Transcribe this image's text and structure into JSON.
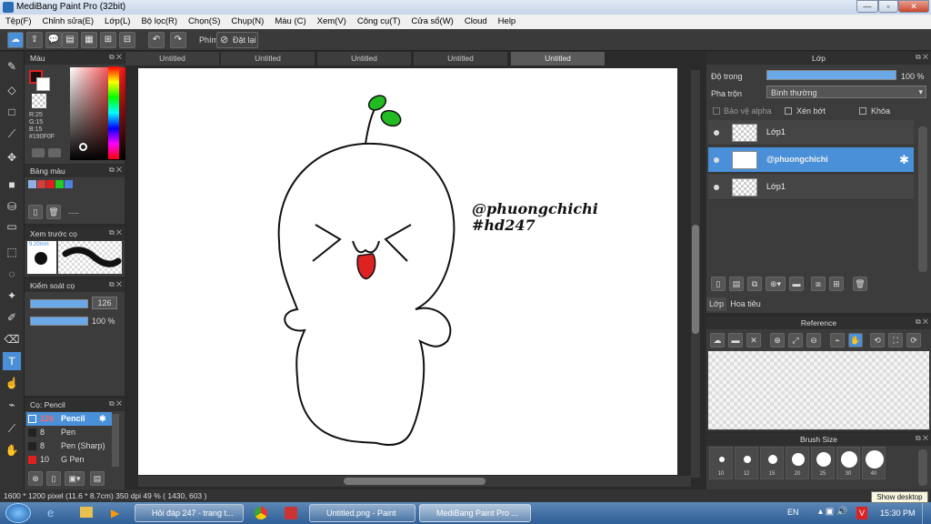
{
  "window": {
    "title": "MediBang Paint Pro (32bit)"
  },
  "menu": [
    "Tệp(F)",
    "Chỉnh sửa(E)",
    "Lớp(L)",
    "Bộ lọc(R)",
    "Chọn(S)",
    "Chụp(N)",
    "Màu (C)",
    "Xem(V)",
    "Công cụ(T)",
    "Cửa sổ(W)",
    "Cloud",
    "Help"
  ],
  "toolbar": {
    "phim_label": "Phím",
    "reset_label": "Đặt lại"
  },
  "tabs": [
    "Untitled",
    "Untitled",
    "Untitled",
    "Untitled",
    "Untitled"
  ],
  "color_panel": {
    "title": "Màu",
    "r": "R:25",
    "g": "G:15",
    "b": "B:15",
    "hex": "#190F0F"
  },
  "palette_panel": {
    "title": "Bảng màu",
    "dashes": "----"
  },
  "brush_preview": {
    "title": "Xem trước cọ",
    "size": "9.20mm"
  },
  "brush_control": {
    "title": "Kiểm soát cọ",
    "size": "126",
    "opacity": "100 %"
  },
  "brush_list": {
    "title": "Cọ: Pencil",
    "items": [
      {
        "size": "126",
        "name": "Pencil",
        "selected": true
      },
      {
        "size": "8",
        "name": "Pen",
        "selected": false
      },
      {
        "size": "8",
        "name": "Pen (Sharp)",
        "selected": false
      },
      {
        "size": "10",
        "name": "G Pen",
        "selected": false
      }
    ]
  },
  "canvas_text": {
    "line1": "@phuongchichi",
    "line2": "#hd247"
  },
  "layer_panel": {
    "title": "Lớp",
    "opacity_label": "Độ trong",
    "opacity_value": "100 %",
    "blend_label": "Pha trộn",
    "blend_value": "Bình thường",
    "protect_alpha": "Bảo vệ alpha",
    "clipping": "Xén bớt",
    "lock": "Khóa",
    "layers": [
      {
        "name": "Lớp1",
        "selected": false
      },
      {
        "name": "@phuongchichi",
        "selected": true
      },
      {
        "name": "Lớp1",
        "selected": false
      }
    ],
    "tab_layer": "Lớp",
    "tab_navigator": "Hoa tiêu"
  },
  "reference_panel": {
    "title": "Reference"
  },
  "brush_size_panel": {
    "title": "Brush Size",
    "sizes": [
      "10",
      "12",
      "15",
      "20",
      "25",
      "30",
      "40"
    ]
  },
  "status": {
    "text": "1600 * 1200 pixel  (11.6 * 8.7cm)  350 dpi  49 %  ( 1430, 603 )"
  },
  "taskbar": {
    "tasks": [
      "Hỏi đáp 247 - trang t...",
      "Untitled.png - Paint",
      "MediBang Paint Pro ..."
    ],
    "lang": "EN",
    "time": "15:30 PM",
    "tooltip": "Show desktop"
  },
  "colors": {
    "accent": "#4a90d9",
    "bg": "#2b2b2b",
    "panel": "#3c3c3c",
    "sprout": "#22bb22",
    "tongue": "#dd2222"
  }
}
